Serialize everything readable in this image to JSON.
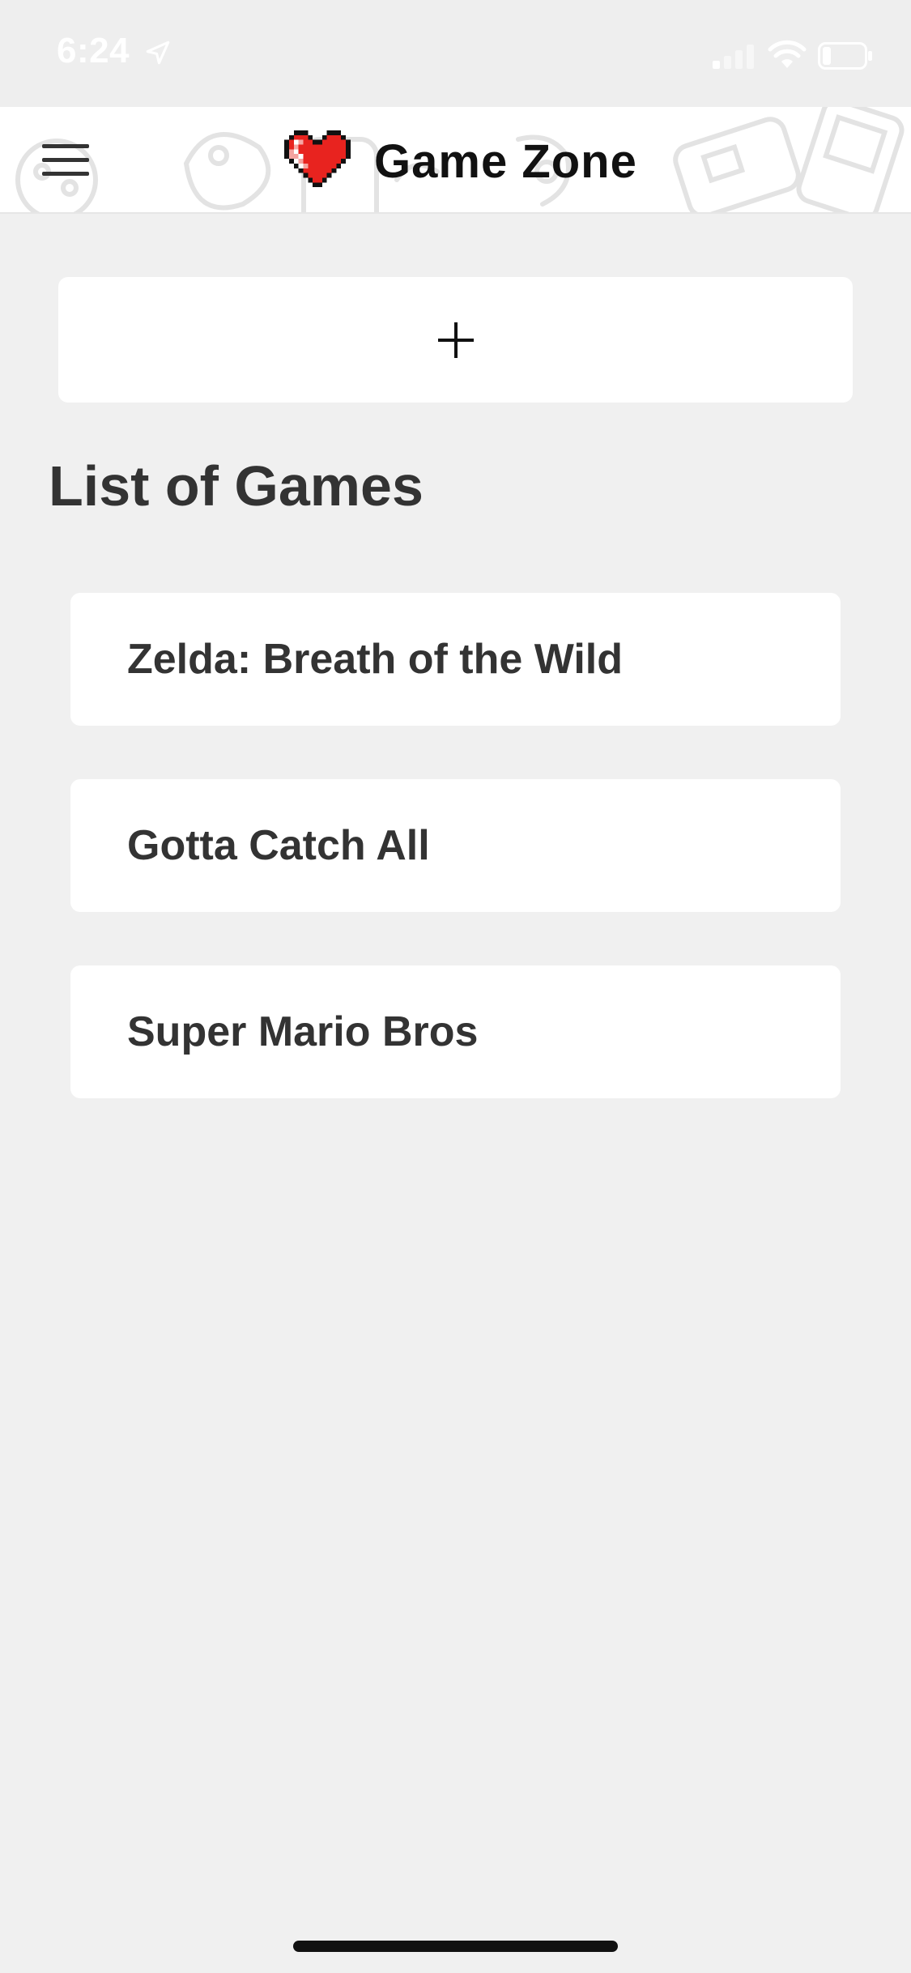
{
  "status_bar": {
    "time": "6:24",
    "icons": [
      "location-arrow-icon",
      "cellular-signal-icon",
      "wifi-icon",
      "battery-icon"
    ]
  },
  "header": {
    "menu_icon": "hamburger-menu-icon",
    "logo_icon": "pixel-heart-icon",
    "title": "Game Zone"
  },
  "add_button": {
    "icon": "plus-icon",
    "label": "+"
  },
  "section": {
    "title": "List of Games"
  },
  "games": [
    {
      "title": "Zelda: Breath of the Wild"
    },
    {
      "title": "Gotta Catch All"
    },
    {
      "title": "Super Mario Bros"
    }
  ],
  "colors": {
    "background": "#f0f0f0",
    "card": "#ffffff",
    "text": "#333333",
    "heart_red": "#e8231f"
  }
}
